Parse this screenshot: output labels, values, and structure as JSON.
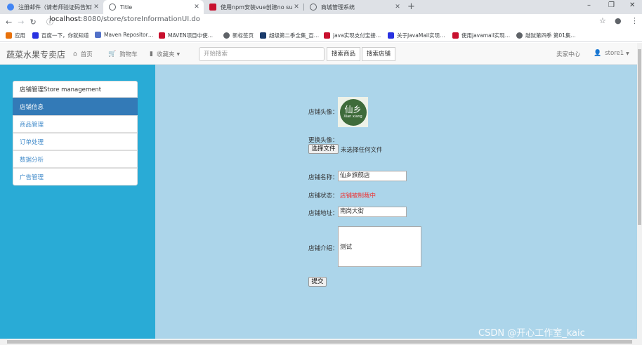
{
  "browser": {
    "tabs": [
      {
        "title": "注册邮件（请老师验证码告知我…",
        "active": false,
        "color": "#4285f4"
      },
      {
        "title": "Title",
        "active": true,
        "color": "#5f6368"
      },
      {
        "title": "使用npm安装vue创建no such fi…",
        "active": false,
        "color": "#c8102e"
      },
      {
        "title": "商城管理系统",
        "active": false,
        "color": "#5f6368"
      }
    ],
    "close_glyph": "✕",
    "new_tab_glyph": "+",
    "window_controls": [
      "–",
      "❐",
      "✕"
    ],
    "url_host": "localhost",
    "url_path": ":8080/store/storeInformationUI.do",
    "bookmarks": [
      {
        "label": "应用",
        "color": "#e8710a"
      },
      {
        "label": "百度一下，你就知道",
        "color": "#2932e1"
      },
      {
        "label": "Maven Repositor…",
        "color": "#5271c8"
      },
      {
        "label": "MAVEN项目中使…",
        "color": "#c8102e"
      },
      {
        "label": "新标签页",
        "color": "#5f6368"
      },
      {
        "label": "超级第二季全集_百…",
        "color": "#1a3a6b"
      },
      {
        "label": "java实现支付宝接…",
        "color": "#c8102e"
      },
      {
        "label": "关于JavaMail实现…",
        "color": "#2932e1"
      },
      {
        "label": "使用javamail实现…",
        "color": "#c8102e"
      },
      {
        "label": "越狱第四季 第01集…",
        "color": "#5f6368"
      }
    ]
  },
  "navbar": {
    "brand": "蔬菜水果专卖店",
    "home": "首页",
    "cart": "购物车",
    "favorites": "收藏夹",
    "search_placeholder": "开始搜索",
    "search_goods": "搜索商品",
    "search_store": "搜索店铺",
    "seller_center": "卖家中心",
    "user": "store1"
  },
  "sidebar": {
    "header": "店铺管理Store management",
    "items": [
      "店铺信息",
      "商品管理",
      "订单处理",
      "数据分析",
      "广告管理"
    ],
    "active_index": 0
  },
  "form": {
    "avatar_label": "店铺头像：",
    "avatar_text_big": "仙乡",
    "avatar_text_small": "Xian xiang",
    "change_avatar_label": "更换头像：",
    "file_button": "选择文件",
    "file_status": "未选择任何文件",
    "name_label": "店铺名称：",
    "name_value": "仙乡旗舰店",
    "state_label": "店铺状态：",
    "state_value": "店铺被制裁中",
    "address_label": "店铺地址：",
    "address_value": "南岗大街",
    "intro_label": "店铺介绍：",
    "intro_value": "测试",
    "submit": "提交"
  },
  "watermark": "CSDN @开心工作室_kaic",
  "colors": {
    "sidebar_bg": "#29abd6",
    "main_bg": "#acd5ea",
    "active_item": "#337ab7",
    "status_red": "#e33333"
  }
}
